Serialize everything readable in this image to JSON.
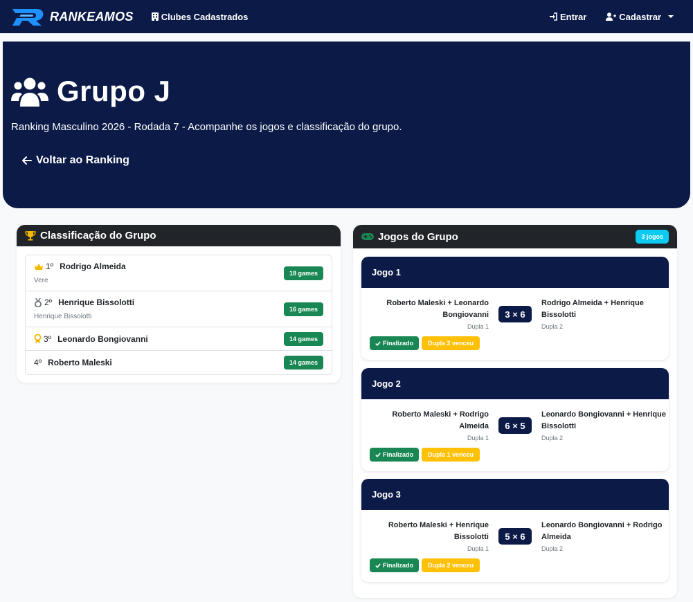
{
  "navbar": {
    "brand": "RANKEAMOS",
    "clubs_link": "Clubes Cadastrados",
    "login_link": "Entrar",
    "register_link": "Cadastrar"
  },
  "hero": {
    "title": "Grupo J",
    "subtitle": "Ranking Masculino 2026 - Rodada 7 - Acompanhe os jogos e classificação do grupo.",
    "back_button": "Voltar ao Ranking"
  },
  "classification": {
    "title": "Classificação do Grupo",
    "rows": [
      {
        "position": "1º",
        "name": "Rodrigo Almeida",
        "subtitle": "Vere",
        "games": "18 games",
        "icon": "crown-icon"
      },
      {
        "position": "2º",
        "name": "Henrique Bissolotti",
        "subtitle": "Henrique Bissolotti",
        "games": "16 games",
        "icon": "silver-medal-icon"
      },
      {
        "position": "3º",
        "name": "Leonardo Bongiovanni",
        "subtitle": "",
        "games": "14 games",
        "icon": "bronze-award-icon"
      },
      {
        "position": "4º",
        "name": "Roberto Maleski",
        "subtitle": "",
        "games": "14 games",
        "icon": ""
      }
    ]
  },
  "games": {
    "title": "Jogos do Grupo",
    "count_badge": "3 jogos",
    "list": [
      {
        "title": "Jogo 1",
        "team1": "Roberto Maleski + Leonardo Bongiovanni",
        "team1_label": "Dupla 1",
        "score": "3 × 6",
        "team2": "Rodrigo Almeida + Henrique Bissolotti",
        "team2_label": "Dupla 2",
        "status": "Finalizado",
        "winner": "Dupla 2 venceu"
      },
      {
        "title": "Jogo 2",
        "team1": "Roberto Maleski + Rodrigo Almeida",
        "team1_label": "Dupla 1",
        "score": "6 × 5",
        "team2": "Leonardo Bongiovanni + Henrique Bissolotti",
        "team2_label": "Dupla 2",
        "status": "Finalizado",
        "winner": "Dupla 1 venceu"
      },
      {
        "title": "Jogo 3",
        "team1": "Roberto Maleski + Henrique Bissolotti",
        "team1_label": "Dupla 1",
        "score": "5 × 6",
        "team2": "Leonardo Bongiovanni + Rodrigo Almeida",
        "team2_label": "Dupla 2",
        "status": "Finalizado",
        "winner": "Dupla 2 venceu"
      }
    ]
  },
  "colors": {
    "navy": "#0b1a47",
    "success": "#198754",
    "warning": "#ffc107",
    "info": "#0dcaf0",
    "gold": "#f5b800"
  }
}
